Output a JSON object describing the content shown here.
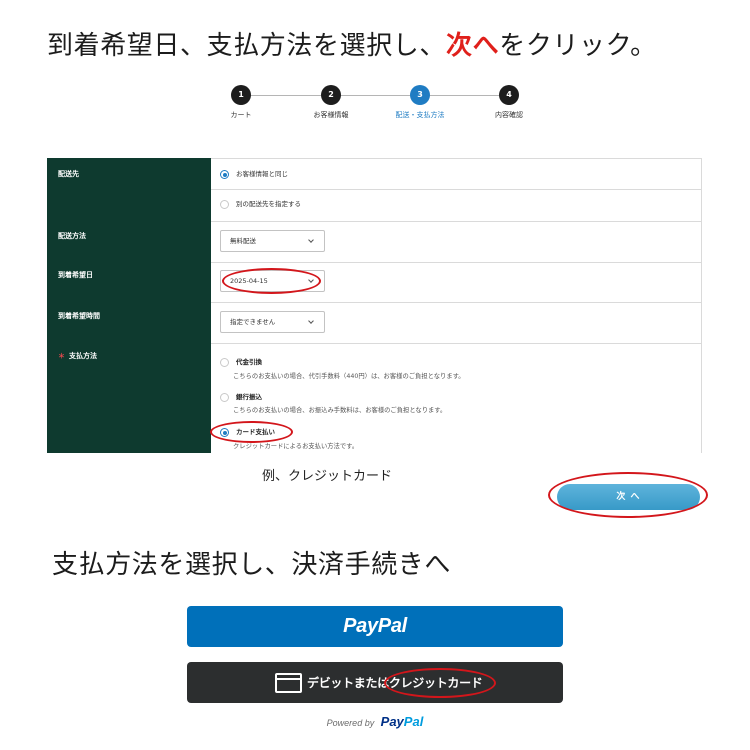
{
  "guide": {
    "heading_top": {
      "before": "到着希望日、支払方法を選択し、",
      "highlight": "次へ",
      "after": "をクリック。"
    },
    "caption": "例、クレジットカード",
    "heading_bottom": "支払方法を選択し、決済手続きへ"
  },
  "stepper": {
    "steps": [
      {
        "number": "1",
        "label": "カート",
        "active": false
      },
      {
        "number": "2",
        "label": "お客様情報",
        "active": false
      },
      {
        "number": "3",
        "label": "配送・支払方法",
        "active": true
      },
      {
        "number": "4",
        "label": "内容確認",
        "active": false
      }
    ]
  },
  "form": {
    "destination": {
      "label": "配送先",
      "options": [
        {
          "label": "お客様情報と同じ",
          "selected": true
        },
        {
          "label": "別の配送先を指定する",
          "selected": false
        }
      ]
    },
    "shipping_method": {
      "label": "配送方法",
      "value": "無料配送"
    },
    "delivery_date": {
      "label": "到着希望日",
      "value": "2025-04-15"
    },
    "delivery_time": {
      "label": "到着希望時間",
      "value": "指定できません"
    },
    "payment": {
      "required_mark": "＊",
      "label": "支払方法",
      "options": [
        {
          "label": "代金引換",
          "description": "こちらのお支払いの場合、代引手数料（440円）は、お客様のご負担となります。",
          "selected": false
        },
        {
          "label": "銀行振込",
          "description": "こちらのお支払いの場合、お振込み手数料は、お客様のご負担となります。",
          "selected": false
        },
        {
          "label": "カード支払い",
          "description": "クレジットカードによるお支払い方法です。",
          "selected": true
        }
      ]
    }
  },
  "next_button": {
    "label": "次 へ"
  },
  "paypal": {
    "paypal_button": {
      "label": "PayPal"
    },
    "card_button": {
      "label_before": "デビットまたは",
      "label_highlight": "クレジットカード"
    },
    "powered_by": {
      "text": "Powered by",
      "brand_pay": "Pay",
      "brand_pal": "Pal"
    }
  },
  "colors": {
    "keyword_red": "#e0201b",
    "form_label_bg": "#0e3a2f",
    "step_active": "#1f7cc3",
    "step_default": "#1d1d1d",
    "required_red": "#e5484d",
    "annotation_red": "#d3161b",
    "next_button_bg": "#3ba3d4",
    "paypal_blue": "#0070ba",
    "card_button_bg": "#2c2e2f",
    "paypal_brand_dark": "#003087",
    "paypal_brand_light": "#009cde"
  }
}
